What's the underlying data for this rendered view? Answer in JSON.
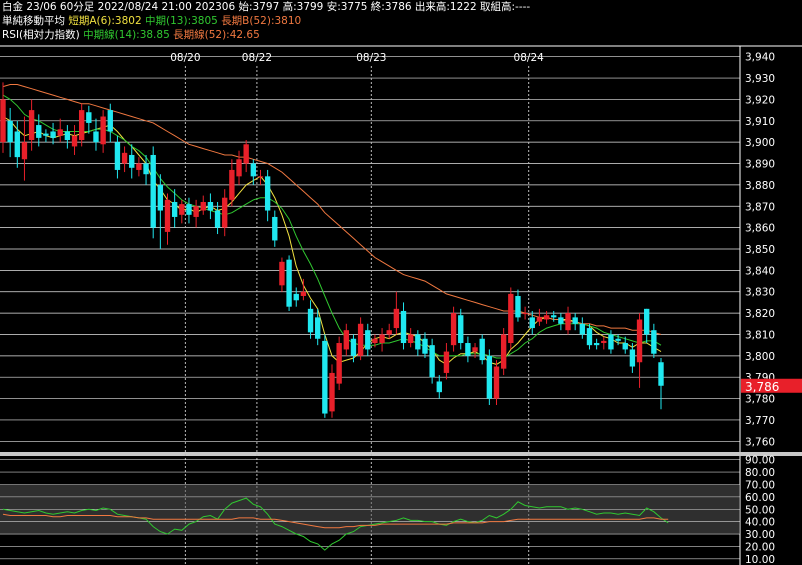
{
  "header": {
    "line1": "白金 23/06 60分足 2022/08/24 21:00 202306 始:3797 高:3799 安:3775 終:3786 出来高:1222 取組高:----",
    "line2_prefix": "単純移動平均",
    "line2_short": "短期A(6):3802",
    "line2_mid": "中期(13):3805",
    "line2_long": "長期B(52):3810",
    "line3_prefix": "RSI(相対力指数)",
    "line3_mid": "中期線(14):38.85",
    "line3_long": "長期線(52):42.65"
  },
  "colors": {
    "background": "#000000",
    "up": "#e8202a",
    "down": "#20e8f0",
    "ma_short": "#f0e040",
    "ma_mid": "#30c830",
    "ma_long": "#f07840",
    "grid": "#ffffff",
    "dategrid": "#bbbbbb",
    "last_price_bg": "#e8202a",
    "rsi_band": "#555555"
  },
  "chart_data": [
    {
      "type": "candlestick",
      "title": "白金 23/06 60分足",
      "x_tick_labels": [
        "08/20",
        "08/22",
        "08/23",
        "08/24"
      ],
      "y_tick_labels": [
        "3,940",
        "3,930",
        "3,920",
        "3,910",
        "3,900",
        "3,890",
        "3,880",
        "3,870",
        "3,860",
        "3,850",
        "3,840",
        "3,830",
        "3,820",
        "3,810",
        "3,800",
        "3,790",
        "3,780",
        "3,770",
        "3,760"
      ],
      "ylim": [
        3755,
        3945
      ],
      "last_price_label": "3,786",
      "last_price": 3786,
      "candles": [
        {
          "o": 3900,
          "c": 3920,
          "h": 3928,
          "l": 3895
        },
        {
          "o": 3910,
          "c": 3900,
          "h": 3916,
          "l": 3893
        },
        {
          "o": 3905,
          "c": 3893,
          "h": 3910,
          "l": 3888
        },
        {
          "o": 3892,
          "c": 3900,
          "h": 3912,
          "l": 3882
        },
        {
          "o": 3901,
          "c": 3915,
          "h": 3920,
          "l": 3896
        },
        {
          "o": 3908,
          "c": 3902,
          "h": 3913,
          "l": 3898
        },
        {
          "o": 3904,
          "c": 3903,
          "h": 3906,
          "l": 3900
        },
        {
          "o": 3905,
          "c": 3902,
          "h": 3909,
          "l": 3899
        },
        {
          "o": 3903,
          "c": 3906,
          "h": 3911,
          "l": 3900
        },
        {
          "o": 3905,
          "c": 3901,
          "h": 3908,
          "l": 3897
        },
        {
          "o": 3898,
          "c": 3903,
          "h": 3908,
          "l": 3894
        },
        {
          "o": 3901,
          "c": 3915,
          "h": 3918,
          "l": 3898
        },
        {
          "o": 3914,
          "c": 3909,
          "h": 3917,
          "l": 3904
        },
        {
          "o": 3905,
          "c": 3900,
          "h": 3911,
          "l": 3896
        },
        {
          "o": 3899,
          "c": 3912,
          "h": 3915,
          "l": 3895
        },
        {
          "o": 3915,
          "c": 3905,
          "h": 3918,
          "l": 3900
        },
        {
          "o": 3900,
          "c": 3887,
          "h": 3903,
          "l": 3883
        },
        {
          "o": 3890,
          "c": 3895,
          "h": 3898,
          "l": 3886
        },
        {
          "o": 3894,
          "c": 3888,
          "h": 3899,
          "l": 3883
        },
        {
          "o": 3887,
          "c": 3890,
          "h": 3893,
          "l": 3884
        },
        {
          "o": 3890,
          "c": 3885,
          "h": 3894,
          "l": 3880
        },
        {
          "o": 3894,
          "c": 3860,
          "h": 3898,
          "l": 3855
        },
        {
          "o": 3880,
          "c": 3868,
          "h": 3885,
          "l": 3850
        },
        {
          "o": 3858,
          "c": 3873,
          "h": 3876,
          "l": 3852
        },
        {
          "o": 3872,
          "c": 3865,
          "h": 3878,
          "l": 3860
        },
        {
          "o": 3866,
          "c": 3871,
          "h": 3873,
          "l": 3862
        },
        {
          "o": 3871,
          "c": 3866,
          "h": 3874,
          "l": 3862
        },
        {
          "o": 3865,
          "c": 3870,
          "h": 3873,
          "l": 3860
        },
        {
          "o": 3868,
          "c": 3872,
          "h": 3875,
          "l": 3866
        },
        {
          "o": 3872,
          "c": 3868,
          "h": 3876,
          "l": 3864
        },
        {
          "o": 3868,
          "c": 3860,
          "h": 3872,
          "l": 3857
        },
        {
          "o": 3860,
          "c": 3874,
          "h": 3878,
          "l": 3856
        },
        {
          "o": 3873,
          "c": 3887,
          "h": 3892,
          "l": 3870
        },
        {
          "o": 3884,
          "c": 3892,
          "h": 3896,
          "l": 3880
        },
        {
          "o": 3890,
          "c": 3899,
          "h": 3901,
          "l": 3886
        },
        {
          "o": 3890,
          "c": 3884,
          "h": 3892,
          "l": 3880
        },
        {
          "o": 3884,
          "c": 3884,
          "h": 3887,
          "l": 3880
        },
        {
          "o": 3884,
          "c": 3868,
          "h": 3887,
          "l": 3863
        },
        {
          "o": 3865,
          "c": 3854,
          "h": 3868,
          "l": 3851
        },
        {
          "o": 3833,
          "c": 3844,
          "h": 3846,
          "l": 3830
        },
        {
          "o": 3845,
          "c": 3823,
          "h": 3847,
          "l": 3821
        },
        {
          "o": 3829,
          "c": 3826,
          "h": 3832,
          "l": 3823
        },
        {
          "o": 3828,
          "c": 3830,
          "h": 3836,
          "l": 3826
        },
        {
          "o": 3822,
          "c": 3811,
          "h": 3826,
          "l": 3808
        },
        {
          "o": 3818,
          "c": 3808,
          "h": 3822,
          "l": 3805
        },
        {
          "o": 3807,
          "c": 3773,
          "h": 3810,
          "l": 3771
        },
        {
          "o": 3774,
          "c": 3792,
          "h": 3796,
          "l": 3771
        },
        {
          "o": 3787,
          "c": 3806,
          "h": 3809,
          "l": 3784
        },
        {
          "o": 3803,
          "c": 3812,
          "h": 3815,
          "l": 3800
        },
        {
          "o": 3808,
          "c": 3800,
          "h": 3810,
          "l": 3797
        },
        {
          "o": 3800,
          "c": 3815,
          "h": 3818,
          "l": 3798
        },
        {
          "o": 3812,
          "c": 3803,
          "h": 3815,
          "l": 3800
        },
        {
          "o": 3806,
          "c": 3808,
          "h": 3810,
          "l": 3804
        },
        {
          "o": 3806,
          "c": 3810,
          "h": 3813,
          "l": 3802
        },
        {
          "o": 3810,
          "c": 3812,
          "h": 3815,
          "l": 3808
        },
        {
          "o": 3813,
          "c": 3822,
          "h": 3830,
          "l": 3810
        },
        {
          "o": 3821,
          "c": 3806,
          "h": 3825,
          "l": 3803
        },
        {
          "o": 3806,
          "c": 3810,
          "h": 3813,
          "l": 3804
        },
        {
          "o": 3810,
          "c": 3803,
          "h": 3812,
          "l": 3800
        },
        {
          "o": 3808,
          "c": 3801,
          "h": 3811,
          "l": 3799
        },
        {
          "o": 3805,
          "c": 3790,
          "h": 3808,
          "l": 3787
        },
        {
          "o": 3788,
          "c": 3783,
          "h": 3791,
          "l": 3780
        },
        {
          "o": 3792,
          "c": 3802,
          "h": 3806,
          "l": 3789
        },
        {
          "o": 3805,
          "c": 3820,
          "h": 3823,
          "l": 3802
        },
        {
          "o": 3819,
          "c": 3806,
          "h": 3822,
          "l": 3803
        },
        {
          "o": 3806,
          "c": 3800,
          "h": 3809,
          "l": 3797
        },
        {
          "o": 3802,
          "c": 3804,
          "h": 3806,
          "l": 3799
        },
        {
          "o": 3808,
          "c": 3798,
          "h": 3810,
          "l": 3796
        },
        {
          "o": 3800,
          "c": 3780,
          "h": 3803,
          "l": 3777
        },
        {
          "o": 3780,
          "c": 3795,
          "h": 3798,
          "l": 3777
        },
        {
          "o": 3794,
          "c": 3810,
          "h": 3813,
          "l": 3791
        },
        {
          "o": 3806,
          "c": 3829,
          "h": 3832,
          "l": 3803
        },
        {
          "o": 3828,
          "c": 3818,
          "h": 3831,
          "l": 3816
        },
        {
          "o": 3820,
          "c": 3820,
          "h": 3823,
          "l": 3817
        },
        {
          "o": 3818,
          "c": 3813,
          "h": 3821,
          "l": 3810
        },
        {
          "o": 3816,
          "c": 3818,
          "h": 3822,
          "l": 3814
        },
        {
          "o": 3817,
          "c": 3819,
          "h": 3821,
          "l": 3815
        },
        {
          "o": 3819,
          "c": 3818,
          "h": 3821,
          "l": 3816
        },
        {
          "o": 3818,
          "c": 3815,
          "h": 3820,
          "l": 3812
        },
        {
          "o": 3812,
          "c": 3820,
          "h": 3823,
          "l": 3810
        },
        {
          "o": 3818,
          "c": 3815,
          "h": 3820,
          "l": 3812
        },
        {
          "o": 3815,
          "c": 3810,
          "h": 3818,
          "l": 3808
        },
        {
          "o": 3813,
          "c": 3805,
          "h": 3815,
          "l": 3803
        },
        {
          "o": 3806,
          "c": 3805,
          "h": 3808,
          "l": 3803
        },
        {
          "o": 3806,
          "c": 3807,
          "h": 3809,
          "l": 3803
        },
        {
          "o": 3810,
          "c": 3803,
          "h": 3812,
          "l": 3801
        },
        {
          "o": 3808,
          "c": 3807,
          "h": 3810,
          "l": 3805
        },
        {
          "o": 3806,
          "c": 3803,
          "h": 3809,
          "l": 3801
        },
        {
          "o": 3803,
          "c": 3795,
          "h": 3806,
          "l": 3792
        },
        {
          "o": 3797,
          "c": 3817,
          "h": 3820,
          "l": 3785
        },
        {
          "o": 3822,
          "c": 3810,
          "h": 3822,
          "l": 3806
        },
        {
          "o": 3812,
          "c": 3801,
          "h": 3815,
          "l": 3799
        },
        {
          "o": 3797,
          "c": 3786,
          "h": 3799,
          "l": 3775
        }
      ],
      "ma_short": [
        3912,
        3910,
        3906,
        3903,
        3904,
        3905,
        3903,
        3902,
        3903,
        3904,
        3903,
        3904,
        3905,
        3906,
        3907,
        3908,
        3905,
        3901,
        3898,
        3894,
        3890,
        3882,
        3878,
        3873,
        3871,
        3868,
        3869,
        3867,
        3869,
        3870,
        3868,
        3869,
        3872,
        3876,
        3880,
        3882,
        3884,
        3880,
        3874,
        3866,
        3856,
        3842,
        3833,
        3827,
        3822,
        3810,
        3800,
        3797,
        3798,
        3799,
        3802,
        3806,
        3808,
        3809,
        3808,
        3810,
        3811,
        3810,
        3809,
        3806,
        3803,
        3798,
        3796,
        3799,
        3801,
        3801,
        3802,
        3800,
        3797,
        3796,
        3798,
        3803,
        3806,
        3810,
        3814,
        3817,
        3818,
        3817,
        3817,
        3817,
        3816,
        3815,
        3814,
        3811,
        3809,
        3808,
        3806,
        3806,
        3804,
        3806,
        3806,
        3804,
        3802
      ],
      "ma_mid": [
        3922,
        3920,
        3917,
        3913,
        3911,
        3910,
        3908,
        3906,
        3905,
        3905,
        3905,
        3905,
        3905,
        3906,
        3906,
        3905,
        3903,
        3901,
        3898,
        3896,
        3893,
        3888,
        3883,
        3879,
        3876,
        3873,
        3871,
        3870,
        3869,
        3868,
        3867,
        3866,
        3867,
        3869,
        3871,
        3873,
        3874,
        3874,
        3872,
        3869,
        3864,
        3856,
        3849,
        3843,
        3836,
        3828,
        3820,
        3813,
        3808,
        3806,
        3805,
        3805,
        3805,
        3806,
        3806,
        3807,
        3808,
        3807,
        3806,
        3804,
        3802,
        3800,
        3800,
        3800,
        3800,
        3801,
        3801,
        3801,
        3800,
        3799,
        3799,
        3801,
        3803,
        3806,
        3808,
        3811,
        3813,
        3814,
        3815,
        3815,
        3815,
        3815,
        3814,
        3813,
        3811,
        3810,
        3809,
        3808,
        3807,
        3806,
        3807,
        3807,
        3805
      ],
      "ma_long": [
        3926,
        3927,
        3927,
        3926,
        3925,
        3924,
        3923,
        3922,
        3921,
        3920,
        3919,
        3918,
        3918,
        3917,
        3916,
        3915,
        3914,
        3913,
        3912,
        3911,
        3910,
        3909,
        3907,
        3905,
        3903,
        3901,
        3899,
        3898,
        3897,
        3896,
        3895,
        3894,
        3894,
        3893,
        3893,
        3892,
        3891,
        3890,
        3888,
        3886,
        3883,
        3880,
        3877,
        3874,
        3871,
        3867,
        3864,
        3861,
        3858,
        3855,
        3852,
        3849,
        3846,
        3844,
        3842,
        3840,
        3838,
        3837,
        3836,
        3835,
        3833,
        3831,
        3829,
        3828,
        3827,
        3826,
        3825,
        3824,
        3823,
        3822,
        3821,
        3821,
        3821,
        3820,
        3819,
        3818,
        3818,
        3817,
        3817,
        3816,
        3816,
        3815,
        3815,
        3814,
        3814,
        3813,
        3813,
        3813,
        3812,
        3812,
        3812,
        3811,
        3810
      ]
    },
    {
      "type": "line",
      "title": "RSI(相対力指数)",
      "y_tick_labels": [
        "90.00",
        "80.00",
        "70.00",
        "60.00",
        "50.00",
        "40.00",
        "30.00",
        "20.00",
        "10.00"
      ],
      "ylim": [
        5,
        93
      ],
      "band": [
        30,
        70
      ],
      "series": [
        {
          "name": "中期線(14)",
          "values": [
            50,
            49,
            48,
            47,
            48,
            49,
            47,
            46,
            47,
            48,
            47,
            49,
            50,
            49,
            51,
            50,
            46,
            45,
            44,
            43,
            42,
            36,
            32,
            30,
            34,
            33,
            38,
            40,
            44,
            45,
            42,
            50,
            55,
            57,
            59,
            54,
            52,
            46,
            38,
            36,
            33,
            30,
            28,
            24,
            22,
            17,
            22,
            25,
            30,
            32,
            36,
            37,
            38,
            39,
            40,
            41,
            43,
            41,
            41,
            40,
            40,
            38,
            37,
            40,
            42,
            40,
            39,
            41,
            45,
            43,
            46,
            50,
            56,
            53,
            52,
            51,
            52,
            52,
            52,
            50,
            51,
            50,
            48,
            46,
            47,
            47,
            46,
            47,
            46,
            45,
            51,
            48,
            43,
            39
          ]
        },
        {
          "name": "長期線(52)",
          "values": [
            46,
            45,
            45,
            45,
            45,
            45,
            45,
            44,
            44,
            45,
            45,
            45,
            45,
            45,
            45,
            45,
            44,
            44,
            44,
            43,
            43,
            42,
            42,
            42,
            42,
            42,
            42,
            42,
            42,
            42,
            42,
            42,
            42,
            43,
            43,
            43,
            42,
            42,
            42,
            41,
            40,
            39,
            38,
            37,
            36,
            35,
            35,
            35,
            36,
            36,
            37,
            37,
            37,
            38,
            38,
            38,
            38,
            38,
            38,
            38,
            38,
            38,
            38,
            39,
            39,
            39,
            39,
            39,
            40,
            40,
            40,
            41,
            42,
            42,
            42,
            42,
            42,
            42,
            42,
            42,
            42,
            42,
            42,
            42,
            42,
            42,
            42,
            42,
            42,
            42,
            43,
            43,
            42,
            42
          ]
        }
      ]
    }
  ]
}
